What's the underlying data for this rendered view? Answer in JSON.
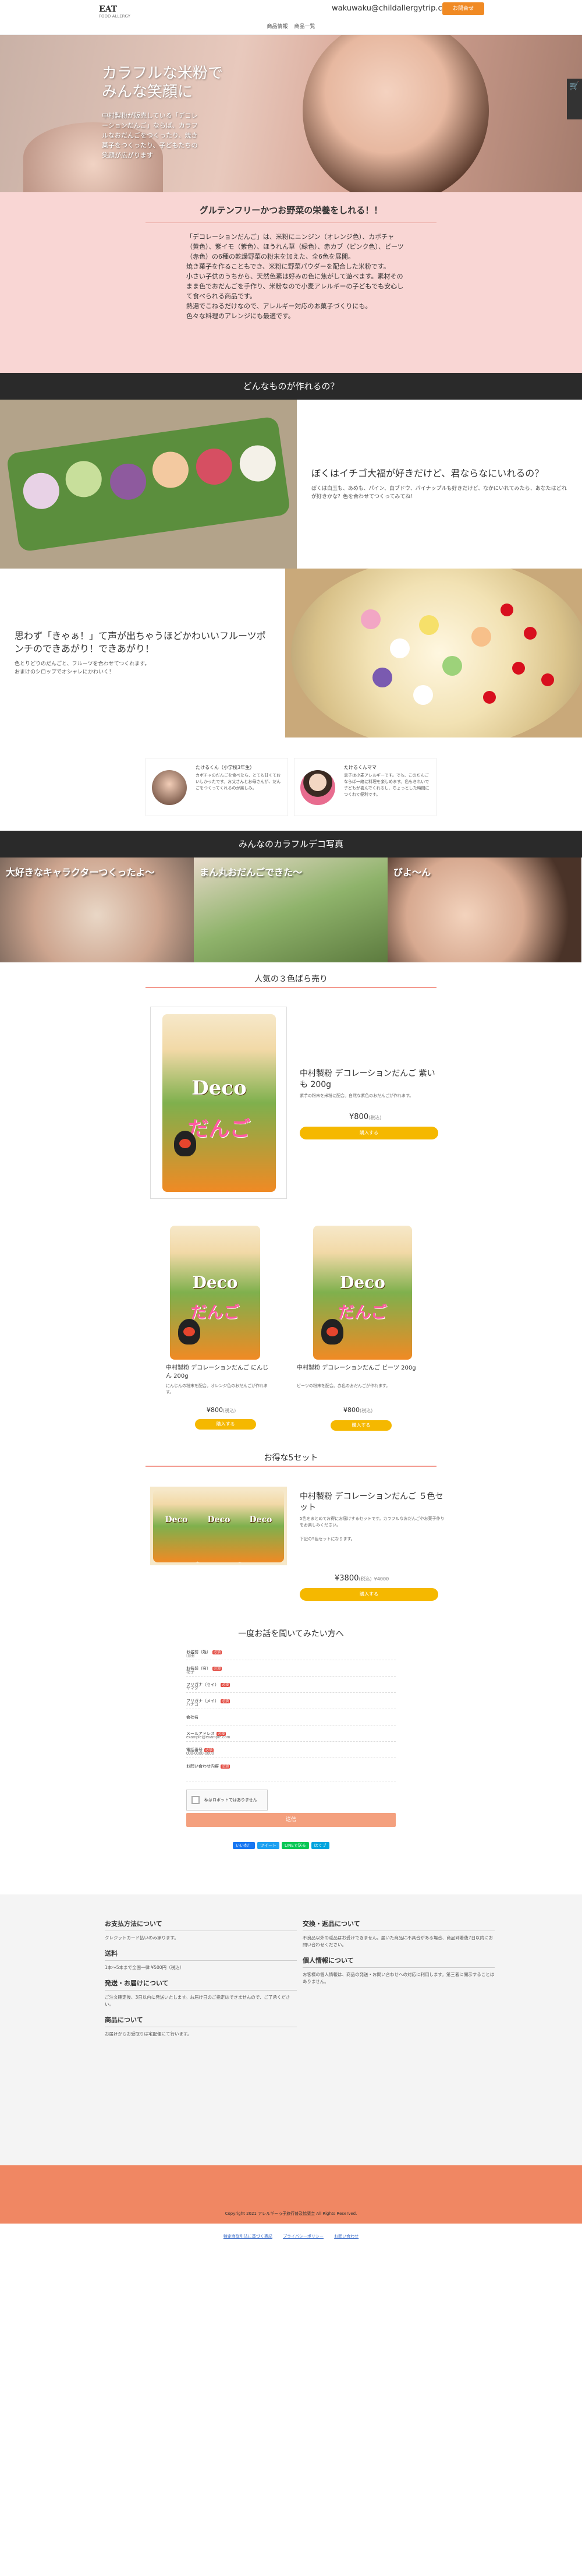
{
  "header": {
    "logo": "EAT",
    "logo_sub": "FOOD ALLERGY",
    "email": "wakuwaku@childallergytrip.com",
    "cta": "お問合せ",
    "nav": [
      "商品情報",
      "商品一覧"
    ]
  },
  "hero": {
    "title_1": "カラフルな米粉で",
    "title_2": "みんな笑顔に",
    "sub": "中村製粉が販売している「デコレーションだんご」ならば、カラフルなおだんごをつくったり、焼き菓子をつくったり、子どもたちの笑顔が広がります"
  },
  "side_tab": {
    "icon": "cart-icon"
  },
  "intro": {
    "heading": "グルテンフリーかつお野菜の栄養をしれる！！",
    "text": "「デコレーションだんご」は、米粉にニンジン（オレンジ色）、カボチャ（黄色）、紫イモ（紫色）、ほうれん草（緑色）、赤カブ（ピンク色）、ビーツ（赤色）の6種の乾燥野菜の粉末を加えた、全6色を展開。\n焼き菓子を作ることもでき、米粉に野菜パウダーを配合した米粉です。\n小さい子供のうちから、天然色素は好みの色に焦がして遊べます。素材そのまま色でおだんごを手作り、米粉なので小麦アレルギーの子どもでも安心して食べられる商品です。\n熱湯でこねるだけなので、アレルギー対応のお菓子づくりにも。\n色々な料理のアレンジにも最適です。"
  },
  "band_1": "どんなものが作れるの？",
  "feature_1": {
    "title": "ぼくはイチゴ大福が好きだけど、君ならなにいれるの？",
    "body": "ぼくは白玉も、あめも、パイン、白ブドウ、パイナップルも好きだけど、なかにいれてみたら、あなたはどれが好きかな？色を合わせてつくってみてね！"
  },
  "feature_2": {
    "title": "思わず「きゃぁ！」て声が出ちゃうほどかわいいフルーツポンチのできあがり！できあがり！",
    "body": "色とりどりのだんごと、フルーツを合わせてつくれます。\nおまけのシロップでオシャレにかわいく！"
  },
  "voices": [
    {
      "name": "たけるくん（小学校3年生）",
      "text": "カボチャのだんごを食べたら、とても甘くておいしかったです。お父さんとお母さんが、だんごをつくってくれるのが楽しみ。"
    },
    {
      "name": "たけるくんママ",
      "text": "息子は小麦アレルギーです。でも、このだんごならば一緒に料理を楽しめます。色もきれいで子どもが喜んでくれるし、ちょっとした時間につくれて便利です。"
    }
  ],
  "band_2": "みんなのカラフルデコ写真",
  "gallery": [
    {
      "label": "大好きなキャラクターつくったよ〜"
    },
    {
      "label": "まん丸おだんごできた〜"
    },
    {
      "label": "びよ〜ん"
    }
  ],
  "popular": {
    "heading": "人気の３色ばら売り",
    "products": [
      {
        "title": "中村製粉 デコレーションだんご 紫いも 200g",
        "desc": "紫芋の粉末を米粉に配合。自然な紫色のおだんごが作れます。",
        "price": "¥800",
        "tax": "(税込)",
        "button": "購入する"
      },
      {
        "title": "中村製粉 デコレーションだんご にんじん 200g",
        "desc": "にんじんの粉末を配合。オレンジ色のおだんごが作れます。",
        "price": "¥800",
        "tax": "(税込)",
        "button": "購入する"
      },
      {
        "title": "中村製粉 デコレーションだんご ビーツ 200g",
        "desc": "ビーツの粉末を配合。赤色のおだんごが作れます。",
        "price": "¥800",
        "tax": "(税込)",
        "button": "購入する"
      }
    ]
  },
  "set": {
    "heading": "お得な5セット",
    "title": "中村製粉 デコレーションだんご ５色セット",
    "desc": "5色をまとめてお得にお届けするセットです。カラフルなおだんごやお菓子作りをお楽しみください。",
    "desc_2": "下記の5色セットになります。",
    "price": "¥3800",
    "tax": "(税込)",
    "old_price": "¥4000",
    "button": "購入する"
  },
  "form": {
    "heading": "一度お話を聞いてみたい方へ",
    "fields": [
      {
        "label": "お名前（姓）",
        "placeholder": "山田"
      },
      {
        "label": "お名前（名）",
        "placeholder": "花子"
      },
      {
        "label": "フリガナ（セイ）",
        "placeholder": "ヤマダ"
      },
      {
        "label": "フリガナ（メイ）",
        "placeholder": "ハナコ"
      },
      {
        "label": "会社名",
        "placeholder": ""
      },
      {
        "label": "メールアドレス",
        "placeholder": "example@example.com"
      },
      {
        "label": "電話番号",
        "placeholder": "000-0000-0000"
      },
      {
        "label": "お問い合わせ内容",
        "placeholder": ""
      }
    ],
    "required": "必須",
    "captcha": "私はロボットではありません",
    "submit": "送信"
  },
  "share": [
    "いいね！",
    "ツイート",
    "LINEで送る",
    "はてブ"
  ],
  "footer": {
    "left": [
      {
        "h": "お支払方法について",
        "p": "クレジットカード払いのみ承ります。"
      },
      {
        "h": "送料",
        "p": "1本〜5本まで全国一律 ¥500円（税込）"
      },
      {
        "h": "発送・お届けについて",
        "p": "ご注文確定後、3日以内に発送いたします。お届け日のご指定はできませんので、ご了承ください。"
      },
      {
        "h": "商品について",
        "p": "お届けからお受取りは宅配便にて行います。"
      }
    ],
    "right": [
      {
        "h": "交換・返品について",
        "p": "不良品以外の返品はお受けできません。届いた商品に不具合がある場合、商品到着後7日以内にお問い合わせください。"
      },
      {
        "h": "個人情報について",
        "p": "お客様の個人情報は、商品の発送・お問い合わせへの対応に利用します。第三者に開示することはありません。"
      }
    ]
  },
  "copyright": "Copyright 2021 アレルギーっ子旅行普及協議会 All Rights Reserved.",
  "bottom_links": [
    "特定商取引法に基づく表記",
    "プライバシーポリシー",
    "お問い合わせ"
  ]
}
